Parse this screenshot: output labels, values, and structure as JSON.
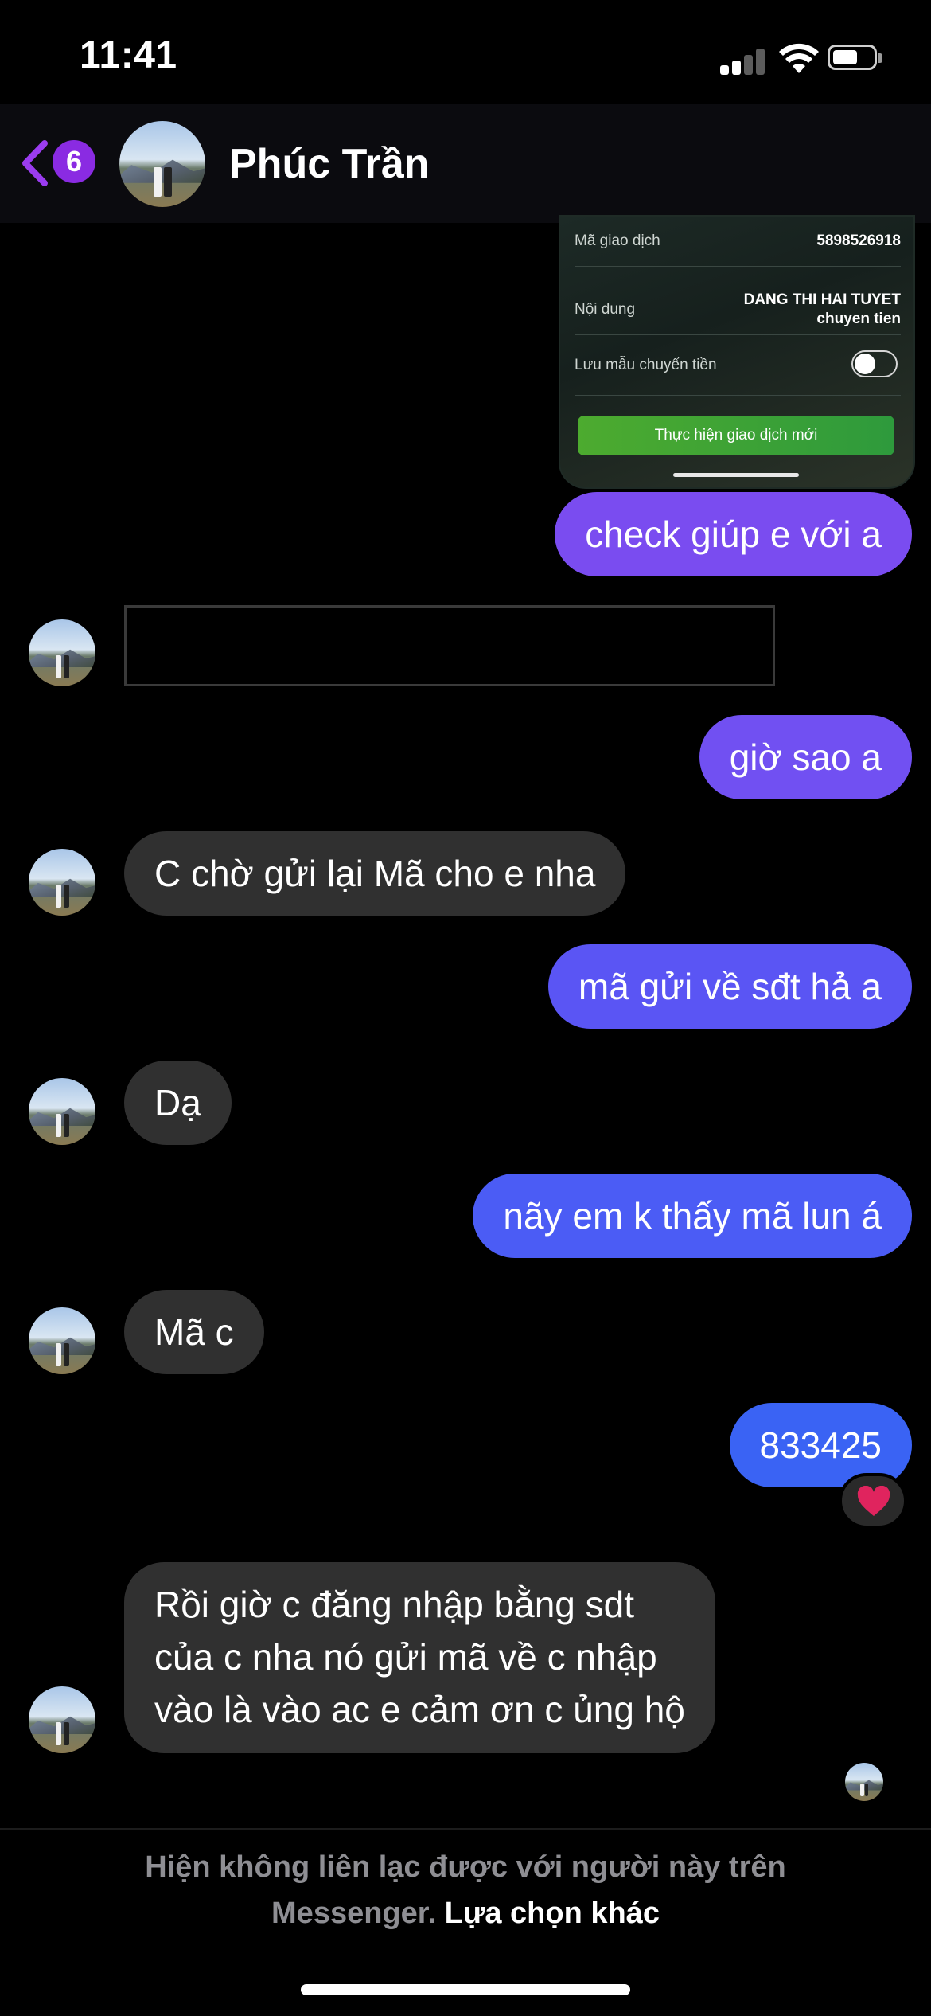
{
  "status_bar": {
    "time": "11:41"
  },
  "header": {
    "back_badge": "6",
    "contact_name": "Phúc Trần"
  },
  "receipt": {
    "rows": [
      {
        "label": "Mã giao dịch",
        "value": "5898526918"
      },
      {
        "label": "Nội dung",
        "value_line1": "DANG THI HAI TUYET",
        "value_line2": "chuyen tien"
      }
    ],
    "save_template_label": "Lưu mẫu chuyển tiền",
    "new_transaction_button": "Thực hiện giao dịch mới"
  },
  "messages": [
    {
      "from": "me",
      "text": "check giúp e với a",
      "color": "#7a4cf0"
    },
    {
      "from": "them",
      "text": ""
    },
    {
      "from": "me",
      "text": "giờ sao a",
      "color": "#7150f2"
    },
    {
      "from": "them",
      "text": "C chờ gửi lại Mã cho e nha"
    },
    {
      "from": "me",
      "text": "mã gửi về sđt hả a",
      "color": "#5a55f4"
    },
    {
      "from": "them",
      "text": "Dạ"
    },
    {
      "from": "me",
      "text": "nãy em k thấy mã lun á",
      "color": "#4b5cf5"
    },
    {
      "from": "them",
      "text": "Mã c"
    },
    {
      "from": "me",
      "text": "833425",
      "color": "#3a63f4",
      "reaction": "heart"
    },
    {
      "from": "them",
      "lines": [
        "Rồi giờ c đăng nhập bằng sdt",
        "của c nha nó gửi mã về c nhập",
        "vào là vào ac e cảm ơn c ủng hộ"
      ]
    }
  ],
  "footer": {
    "notice_line1": "Hiện không liên lạc được với người này trên",
    "notice_line2_prefix": "Messenger.",
    "notice_link": "Lựa chọn khác"
  },
  "icons": {
    "back": "chevron-left-icon",
    "signal": "cellular-signal-icon",
    "wifi": "wifi-icon",
    "battery": "battery-icon",
    "reaction": "heart-icon"
  },
  "colors": {
    "background": "#000000",
    "incoming_bubble": "#303030",
    "accent_purple": "#8a2be2",
    "reaction_heart": "#e0245e"
  }
}
